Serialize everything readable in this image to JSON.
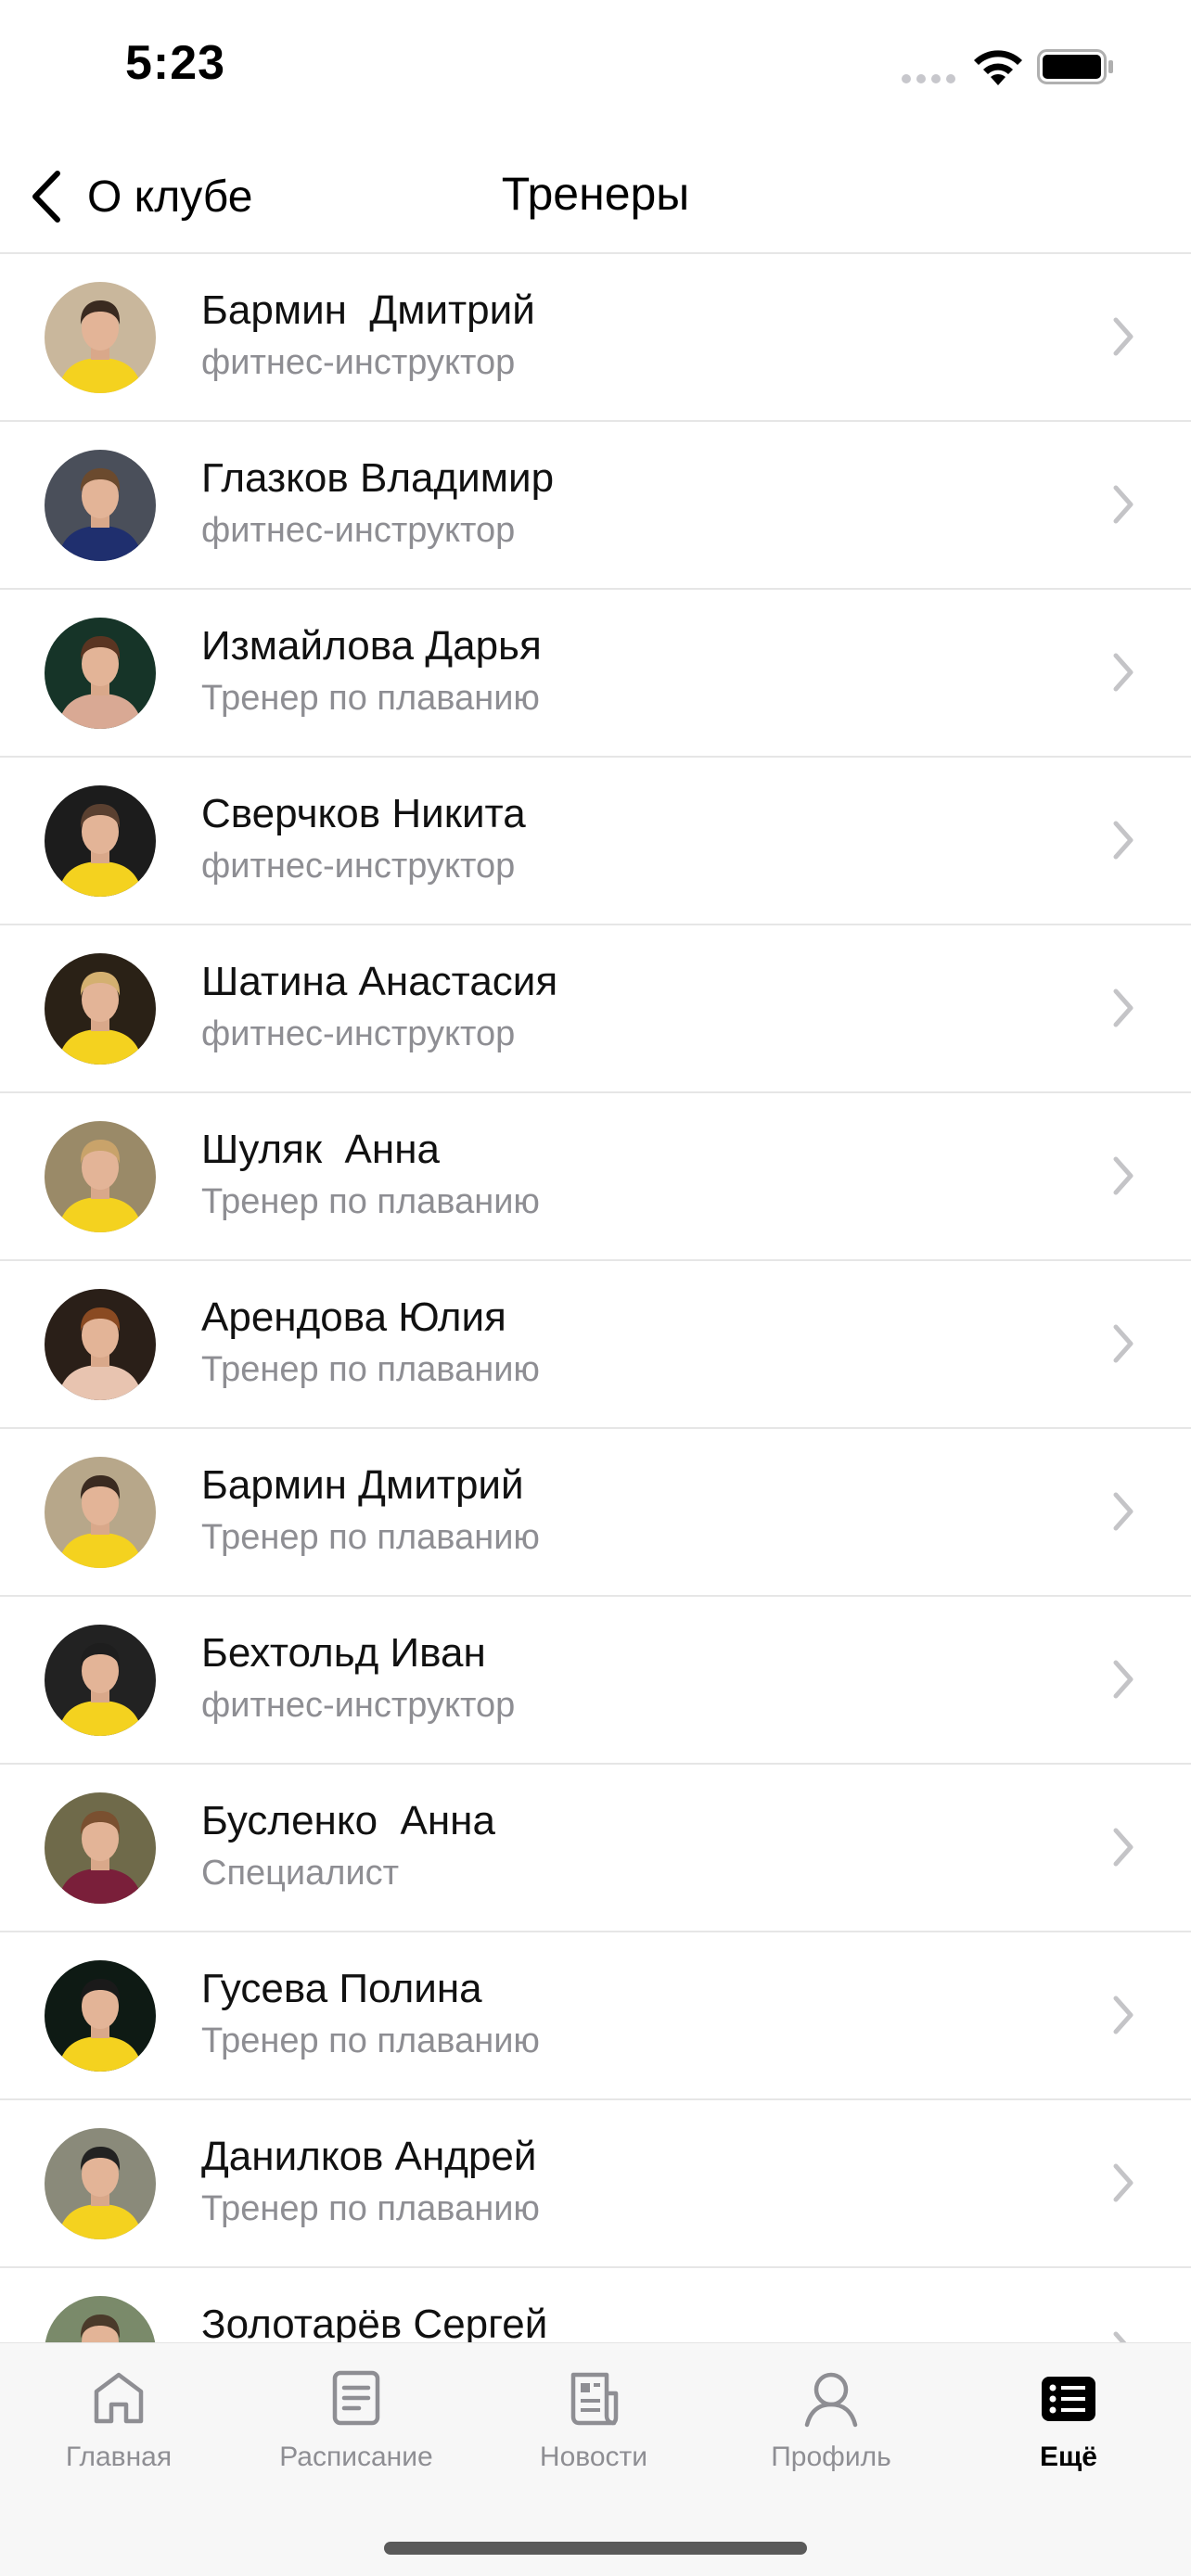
{
  "status_bar": {
    "time": "5:23"
  },
  "nav": {
    "back_label": "О клубе",
    "title": "Тренеры"
  },
  "trainers": [
    {
      "name": "Бармин  Дмитрий",
      "role": "фитнес-инструктор",
      "bg": "#c9b79c",
      "shirt": "#f4d21f",
      "hair": "#3a2a20"
    },
    {
      "name": "Глазков Владимир",
      "role": "фитнес-инструктор",
      "bg": "#4a4f5a",
      "shirt": "#1f2f6e",
      "hair": "#6b4a2e"
    },
    {
      "name": "Измайлова Дарья",
      "role": "Тренер по плаванию",
      "bg": "#163428",
      "shirt": "#d9a994",
      "hair": "#5a3522"
    },
    {
      "name": "Сверчков Никита",
      "role": "фитнес-инструктор",
      "bg": "#1c1c1c",
      "shirt": "#f4d21f",
      "hair": "#5a4030"
    },
    {
      "name": "Шатина Анастасия",
      "role": "фитнес-инструктор",
      "bg": "#2a2116",
      "shirt": "#f4d21f",
      "hair": "#d4b070"
    },
    {
      "name": "Шуляк  Анна",
      "role": "Тренер по плаванию",
      "bg": "#9a8a68",
      "shirt": "#f4d21f",
      "hair": "#c9a36a"
    },
    {
      "name": "Арендова Юлия",
      "role": "Тренер по плаванию",
      "bg": "#2a1f18",
      "shirt": "#e8c4b0",
      "hair": "#8a4a22"
    },
    {
      "name": "Бармин Дмитрий",
      "role": "Тренер по плаванию",
      "bg": "#b7a78a",
      "shirt": "#f4d21f",
      "hair": "#3a2a20"
    },
    {
      "name": "Бехтольд Иван",
      "role": "фитнес-инструктор",
      "bg": "#222222",
      "shirt": "#f4d21f",
      "hair": "#1e1e1e"
    },
    {
      "name": "Бусленко  Анна",
      "role": "Специалист",
      "bg": "#6f6a4a",
      "shirt": "#7a1f3a",
      "hair": "#7a5030"
    },
    {
      "name": "Гусева Полина",
      "role": "Тренер по плаванию",
      "bg": "#0e1a14",
      "shirt": "#f4d21f",
      "hair": "#1a1a1a"
    },
    {
      "name": "Данилков Андрей",
      "role": "Тренер по плаванию",
      "bg": "#8a8a7a",
      "shirt": "#f4d21f",
      "hair": "#222222"
    },
    {
      "name": "Золотарёв Сергей",
      "role": "",
      "bg": "#7a8a6a",
      "shirt": "#f4d21f",
      "hair": "#4a3a2a"
    }
  ],
  "tabs": [
    {
      "label": "Главная",
      "icon": "home-icon",
      "active": false
    },
    {
      "label": "Расписание",
      "icon": "schedule-icon",
      "active": false
    },
    {
      "label": "Новости",
      "icon": "news-icon",
      "active": false
    },
    {
      "label": "Профиль",
      "icon": "profile-icon",
      "active": false
    },
    {
      "label": "Ещё",
      "icon": "more-list-icon",
      "active": true
    }
  ],
  "colors": {
    "accent_yellow": "#f4d21f",
    "secondary_text": "#8e8e93",
    "separator": "#e6e6e6",
    "chevron": "#c4c4c7"
  }
}
